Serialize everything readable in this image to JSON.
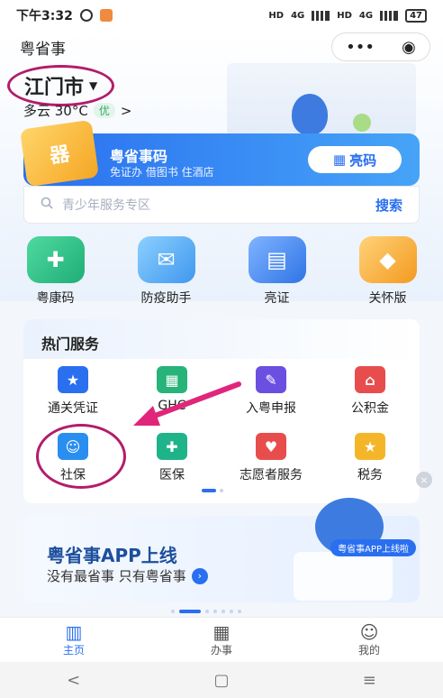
{
  "status_bar": {
    "time": "下午3:32",
    "hd1": "HD",
    "net1": "4G",
    "hd2": "HD",
    "net2": "4G",
    "battery": "47"
  },
  "header": {
    "app_title": "粤省事",
    "more_icon": "•••",
    "target_icon": "◉",
    "city": "江门市",
    "weather": "多云 30°C",
    "air_quality": "优",
    "weather_arrow": ">"
  },
  "code_card": {
    "title": "粤省事码",
    "subtitle": "免证办 借图书 住酒店",
    "button": "亮码",
    "icon_text": "器"
  },
  "search": {
    "placeholder": "青少年服务专区",
    "button": "搜索"
  },
  "quick_actions": [
    {
      "label": "粤康码",
      "icon": "health-code-icon",
      "color": "#2bc18a"
    },
    {
      "label": "防疫助手",
      "icon": "epidemic-helper-icon",
      "color": "#4ba7f5"
    },
    {
      "label": "亮证",
      "icon": "id-card-icon",
      "color": "#3d86ee"
    },
    {
      "label": "关怀版",
      "icon": "care-gift-icon",
      "color": "#f6a22b"
    }
  ],
  "hot_services": {
    "title": "热门服务",
    "items": [
      {
        "label": "通关凭证",
        "icon": "customs-pass-icon",
        "color": "#2a6ff0"
      },
      {
        "label": "GHC",
        "icon": "ghc-icon",
        "color": "#27b37a"
      },
      {
        "label": "入粤申报",
        "icon": "entry-report-icon",
        "color": "#6a4fe0"
      },
      {
        "label": "公积金",
        "icon": "housing-fund-icon",
        "color": "#e84d4d"
      },
      {
        "label": "社保",
        "icon": "social-security-icon",
        "color": "#2a8ef0"
      },
      {
        "label": "医保",
        "icon": "medical-insurance-icon",
        "color": "#1fb38a"
      },
      {
        "label": "志愿者服务",
        "icon": "volunteer-icon",
        "color": "#e84d4d"
      },
      {
        "label": "税务",
        "icon": "tax-icon",
        "color": "#f4b628"
      }
    ]
  },
  "banner": {
    "title": "粤省事APP上线",
    "subtitle": "没有最省事  只有粤省事",
    "pill": "粤省事APP上线啦",
    "close": "×"
  },
  "tab_bar": [
    {
      "label": "主页",
      "icon": "home-icon",
      "glyph": "▥",
      "active": true
    },
    {
      "label": "办事",
      "icon": "calendar-icon",
      "glyph": "▦",
      "active": false
    },
    {
      "label": "我的",
      "icon": "profile-icon",
      "glyph": "☺",
      "active": false
    }
  ],
  "nav_bar": {
    "back": "<",
    "home": "▢",
    "menu": "≡"
  },
  "colors": {
    "accent": "#2a6ff0",
    "annotation": "#b31c6a",
    "arrow": "#e0267a"
  }
}
